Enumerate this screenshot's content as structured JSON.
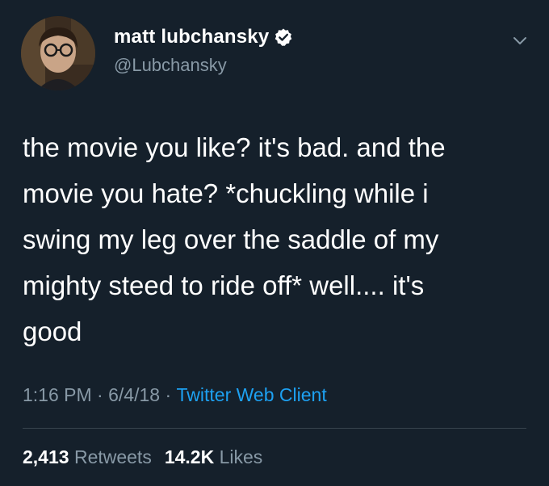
{
  "user": {
    "display_name": "matt lubchansky",
    "handle": "@Lubchansky",
    "verified": true
  },
  "tweet": {
    "text": "the movie you like? it's bad. and the\nmovie you hate? *chuckling while i\nswing my leg over the saddle of my\nmighty steed to ride off* well.... it's\ngood",
    "time": "1:16 PM",
    "date": "6/4/18",
    "separator": " · ",
    "client": "Twitter Web Client"
  },
  "stats": {
    "retweets_count": "2,413",
    "retweets_label": " Retweets",
    "likes_count": "14.2K",
    "likes_label": " Likes"
  },
  "icons": {
    "verified": "verified-badge-icon",
    "menu": "chevron-down-icon"
  },
  "colors": {
    "background": "#15202b",
    "text": "#ffffff",
    "secondary": "#8899a6",
    "link": "#1da1f2",
    "divider": "#38444d"
  }
}
